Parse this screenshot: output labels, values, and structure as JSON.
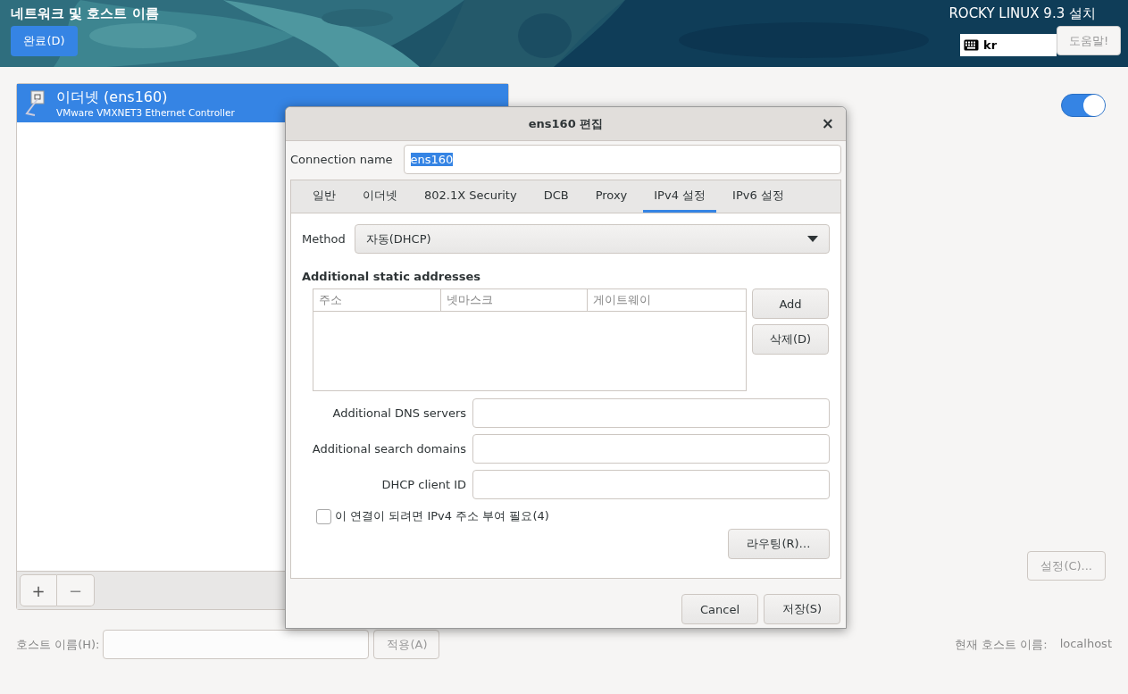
{
  "header": {
    "title": "네트워크 및 호스트 이름",
    "done_button": "완료(D)",
    "product": "ROCKY LINUX 9.3 설치",
    "keyboard_layout": "kr",
    "help_button": {
      "label": "도움말!",
      "disabled": true
    }
  },
  "devices": [
    {
      "name": "이더넷 (ens160)",
      "description": "VMware VMXNET3 Ethernet Controller",
      "selected": true
    }
  ],
  "list_buttons": [
    {
      "label": "+",
      "disabled": false
    },
    {
      "label": "−",
      "disabled": true
    }
  ],
  "device_detail": {
    "on": true,
    "configure_button": {
      "label": "설정(C)...",
      "disabled": true
    }
  },
  "hostname": {
    "label": "호스트 이름(H):",
    "apply_button": {
      "label": "적용(A)",
      "disabled": true
    },
    "current_label": "현재 호스트 이름:",
    "current_value": "localhost"
  },
  "dialog": {
    "title": "ens160 편집",
    "close": "×",
    "connection_name_label": "Connection name",
    "connection_name": {
      "value": "ens160",
      "text_selected": true
    },
    "tabs": [
      {
        "label": "일반",
        "selected": false
      },
      {
        "label": "이더넷",
        "selected": false
      },
      {
        "label": "802.1X Security",
        "selected": false
      },
      {
        "label": "DCB",
        "selected": false
      },
      {
        "label": "Proxy",
        "selected": false
      },
      {
        "label": "IPv4 설정",
        "selected": true
      },
      {
        "label": "IPv6 설정",
        "selected": false
      }
    ],
    "method_label": "Method",
    "method": "자동(DHCP)",
    "static_title": "Additional static addresses",
    "columns": [
      "주소",
      "넷마스크",
      "게이트웨이"
    ],
    "add_button": "Add",
    "delete_button": "삭제(D)",
    "fields": [
      {
        "label": "Additional DNS servers"
      },
      {
        "label": "Additional search domains"
      },
      {
        "label": "DHCP client ID"
      }
    ],
    "require_ipv4": {
      "label": "이 연결이 되려면 IPv4 주소 부여 필요(4)",
      "checked": false
    },
    "routes_button": "라우팅(R)…",
    "buttons": [
      "Cancel",
      "저장(S)"
    ]
  }
}
